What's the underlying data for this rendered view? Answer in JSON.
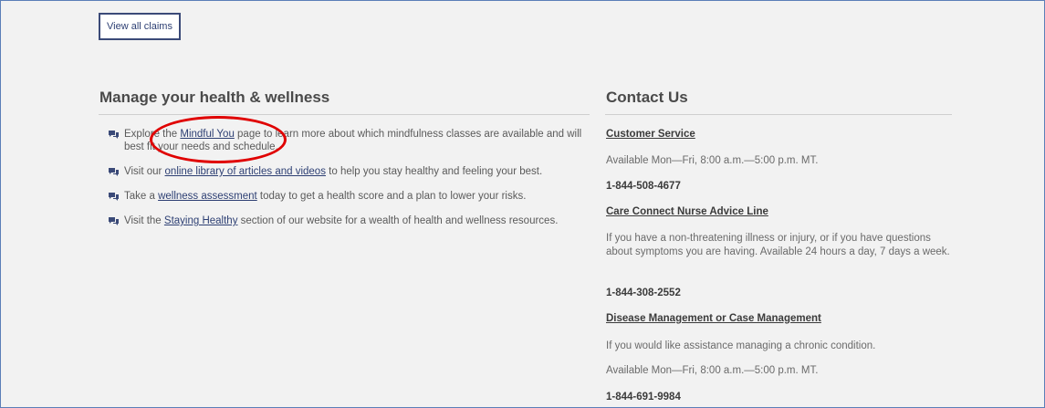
{
  "view_all_claims": "View all claims",
  "health": {
    "title": "Manage your health & wellness",
    "items": [
      {
        "pre": "Explore the ",
        "link": "Mindful You",
        "post": " page to learn more about which mindfulness classes are available and will best fit your needs and schedule."
      },
      {
        "pre": "Visit our ",
        "link": "online library of articles and videos",
        "post": " to help you stay healthy and feeling your best."
      },
      {
        "pre": "Take a ",
        "link": "wellness assessment",
        "post": " today to get a health score and a plan to lower your risks."
      },
      {
        "pre": "Visit the ",
        "link": "Staying Healthy",
        "post": " section of our website for a wealth of health and wellness resources."
      }
    ]
  },
  "contact": {
    "title": "Contact Us",
    "customer_service": {
      "heading": "Customer Service",
      "hours": "Available Mon—Fri, 8:00 a.m.—5:00 p.m. MT.",
      "phone": "1-844-508-4677"
    },
    "nurse_line": {
      "heading": "Care Connect Nurse Advice Line",
      "text": "If you have a non-threatening illness or injury, or if you have questions about symptoms you are having.  Available 24 hours a day,  7 days a week.",
      "phone": "1-844-308-2552"
    },
    "disease_mgmt": {
      "heading": "Disease Management or Case Management",
      "text": "If you would like assistance managing a chronic condition.",
      "hours": "Available Mon—Fri, 8:00 a.m.—5:00 p.m. MT.",
      "phone": "1-844-691-9984"
    }
  },
  "colors": {
    "link": "#2d3f73",
    "annotation": "#e00000",
    "background": "#f2f2f2"
  }
}
